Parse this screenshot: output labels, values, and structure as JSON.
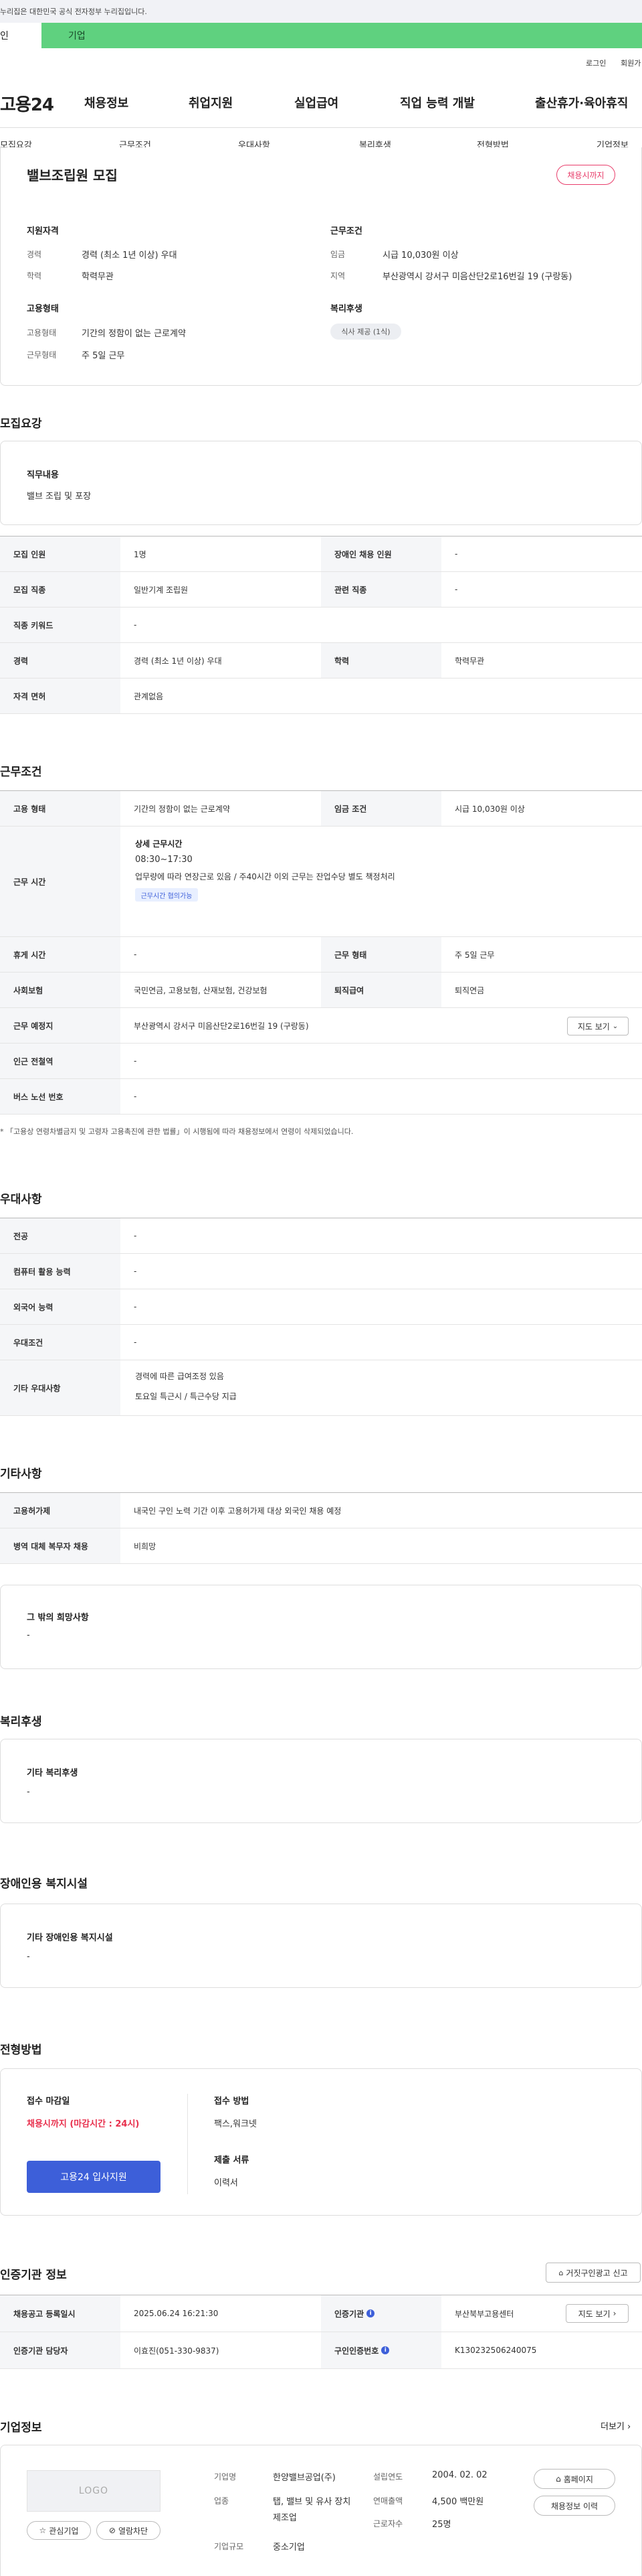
{
  "gov_notice": "이 누리집은 대한민국 공식 전자정부 누리집입니다.",
  "gov_notice_visible": "누리집은 대한민국 공식 전자정부 누리집입니다.",
  "type_tabs": {
    "personal": "개인",
    "personal_visible": "인",
    "company": "기업"
  },
  "util": {
    "login": "로그인",
    "join": "회원가"
  },
  "logo": "고용24",
  "gnb": [
    "채용정보",
    "취업지원",
    "실업급여",
    "직업 능력 개발",
    "출산휴가·육아휴직"
  ],
  "subnav": [
    "모집요강",
    "근무조건",
    "우대사항",
    "복리후생",
    "전형방법",
    "기업정보"
  ],
  "summary": {
    "title": "밸브조립원 모집",
    "status_pill": "채용시까지",
    "qual_heading": "지원자격",
    "qual": [
      {
        "label": "경력",
        "value": "경력 (최소 1년 이상) 우대"
      },
      {
        "label": "학력",
        "value": "학력무관"
      }
    ],
    "cond_heading": "근무조건",
    "cond": [
      {
        "label": "임금",
        "value": "시급 10,030원 이상"
      },
      {
        "label": "지역",
        "value": "부산광역시 강서구 미음산단2로16번길 19 (구랑동)"
      }
    ],
    "emp_heading": "고용형태",
    "emp": [
      {
        "label": "고용형태",
        "value": "기간의 정함이 없는 근로계약"
      },
      {
        "label": "근무형태",
        "value": "주 5일 근무"
      }
    ],
    "welfare_heading": "복리후생",
    "welfare_tag": "식사 제공 (1식)"
  },
  "recruit": {
    "title": "모집요강",
    "duty_label": "직무내용",
    "duty_value": "밸브 조립 및 포장",
    "rows": [
      {
        "k1": "모집 인원",
        "v1": "1명",
        "k2": "장애인 채용 인원",
        "v2": "-"
      },
      {
        "k1": "모집 직종",
        "v1": "일반기계 조립원",
        "k2": "관련 직종",
        "v2": "-"
      },
      {
        "k1": "직종 키워드",
        "v1": "-"
      },
      {
        "k1": "경력",
        "v1": "경력 (최소 1년 이상) 우대",
        "k2": "학력",
        "v2": "학력무관"
      },
      {
        "k1": "자격 면허",
        "v1": "관계없음"
      }
    ]
  },
  "work": {
    "title": "근무조건",
    "emp_type_label": "고용 형태",
    "emp_type": "기간의 정함이 없는 근로계약",
    "wage_label": "임금 조건",
    "wage": "시급 10,030원 이상",
    "hours_label": "근무 시간",
    "hours_title": "상세 근무시간",
    "hours_time": "08:30~17:30",
    "hours_note": "업무량에 따라 연장근로 있음 / 주40시간 이외 근무는 잔업수당 별도 책정처리",
    "hours_tag": "근무시간 협의가능",
    "rest_label": "휴게 시간",
    "rest": "-",
    "form_label": "근무 형태",
    "form": "주 5일 근무",
    "insurance_label": "사회보험",
    "insurance": "국민연금, 고용보험, 산재보험, 건강보험",
    "severance_label": "퇴직급여",
    "severance": "퇴직연금",
    "place_label": "근무 예정지",
    "place": "부산광역시 강서구 미음산단2로16번길 19 (구랑동)",
    "map_btn": "지도 보기",
    "station_label": "인근 전철역",
    "station": "-",
    "bus_label": "버스 노선 번호",
    "bus": "-",
    "footnote": "「고용상 연령차별금지 및 고령자 고용촉진에 관한 법률」이 시행됨에 따라 채용정보에서 연령이 삭제되었습니다."
  },
  "pref": {
    "title": "우대사항",
    "rows": [
      {
        "k": "전공",
        "v": "-"
      },
      {
        "k": "컴퓨터 활용 능력",
        "v": "-"
      },
      {
        "k": "외국어 능력",
        "v": "-"
      },
      {
        "k": "우대조건",
        "v": "-"
      }
    ],
    "other_label": "기타 우대사항",
    "other_values": [
      "경력에 따른 급여조정 있음",
      "토요일 특근시 / 특근수당 지급"
    ]
  },
  "etc": {
    "title": "기타사항",
    "rows": [
      {
        "k": "고용허가제",
        "v": "내국인 구인 노력 기간 이후 고용허가제 대상 외국인 채용 예정"
      },
      {
        "k": "병역 대체 복무자 채용",
        "v": "비희망"
      }
    ],
    "other_label": "그 밖의 희망사항",
    "other_value": "-"
  },
  "benefit": {
    "title": "복리후생",
    "label": "기타 복리후생",
    "value": "-"
  },
  "disability": {
    "title": "장애인용 복지시설",
    "label": "기타 장애인용 복지시설",
    "value": "-"
  },
  "selection": {
    "title": "전형방법",
    "deadline_label": "접수 마감일",
    "deadline_value": "채용시까지 (마감시간 : 24시)",
    "apply_btn": "고용24 입사지원",
    "method_label": "접수 방법",
    "method_value": "팩스,워크넷",
    "docs_label": "제출 서류",
    "docs_value": "이력서"
  },
  "agency": {
    "title": "인증기관 정보",
    "report_btn": "거짓구인광고 신고",
    "reg_label": "채용공고 등록일시",
    "reg_value": "2025.06.24 16:21:30",
    "agency_label": "인증기관",
    "agency_value": "부산북부고용센터",
    "map_btn": "지도 보기",
    "staff_label": "인증기관 담당자",
    "staff_value": "이효진(051-330-9837)",
    "num_label": "구인인증번호",
    "num_value": "K130232506240075"
  },
  "company": {
    "title": "기업정보",
    "more": "더보기",
    "logo_text": "LOGO",
    "interest_btn": "관심기업",
    "block_btn": "열람차단",
    "name_label": "기업명",
    "name_value": "한양밸브공업(주)",
    "industry_label": "업종",
    "industry_value": "탭, 밸브 및 유사 장치 제조업",
    "size_label": "기업규모",
    "size_value": "중소기업",
    "founded_label": "설립연도",
    "founded_value": "2004. 02. 02",
    "sales_label": "연매출액",
    "sales_value": "4,500 백만원",
    "workers_label": "근로자수",
    "workers_value": "25명",
    "homepage_btn": "홈페이지",
    "jobs_btn": "채용정보 이력"
  }
}
